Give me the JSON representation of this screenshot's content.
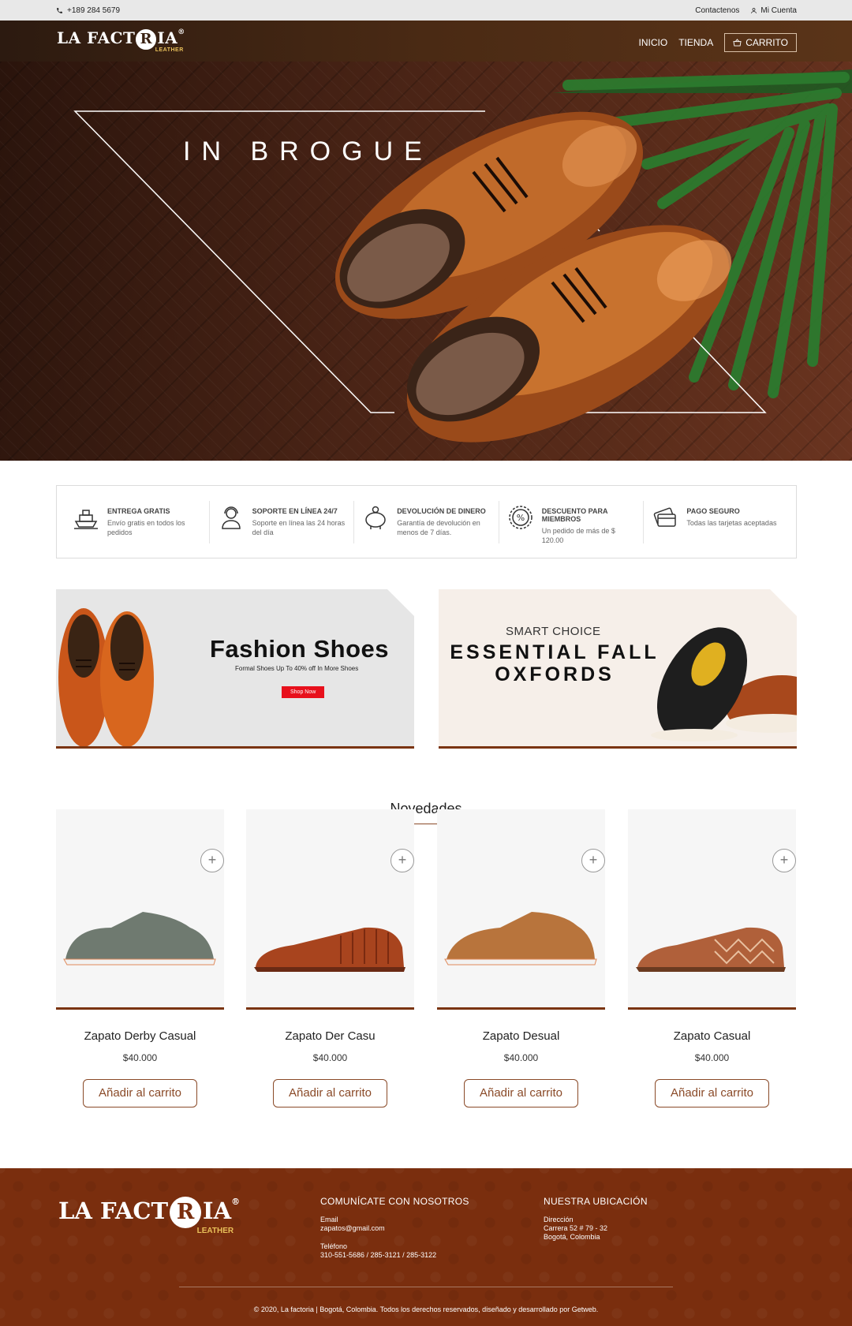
{
  "topbar": {
    "phone": "+189 284 5679",
    "contact": "Contactenos",
    "account": "Mi Cuenta"
  },
  "header": {
    "logo_text_a": "LA FACT",
    "logo_r": "R",
    "logo_text_b": "IA",
    "logo_reg": "®",
    "logo_sub": "LEATHER",
    "nav": {
      "home": "INICIO",
      "shop": "TIENDA",
      "cart": "CARRITO"
    }
  },
  "hero": {
    "title": "IN BROGUE"
  },
  "features": [
    {
      "icon": "ship-icon",
      "title": "ENTREGA GRATIS",
      "text": "Envío gratis en todos los pedidos"
    },
    {
      "icon": "support-agent-icon",
      "title": "SOPORTE EN LÍNEA 24/7",
      "text": "Soporte en línea las 24 horas del día"
    },
    {
      "icon": "piggy-bank-icon",
      "title": "DEVOLUCIÓN DE DINERO",
      "text": "Garantía de devolución en menos de 7 días."
    },
    {
      "icon": "discount-badge-icon",
      "title": "DESCUENTO PARA MIEMBROS",
      "text": "Un pedido de más de $ 120.00"
    },
    {
      "icon": "credit-card-icon",
      "title": "PAGO SEGURO",
      "text": "Todas las tarjetas aceptadas"
    }
  ],
  "banners": {
    "fashion": {
      "title": "Fashion Shoes",
      "subtitle": "Formal Shoes Up To 40% off In More Shoes",
      "button": "Shop Now"
    },
    "oxfords": {
      "kicker": "SMART CHOICE",
      "title_line1": "ESSENTIAL FALL",
      "title_line2": "OXFORDS"
    }
  },
  "novedades": {
    "title": "Novedades",
    "products": [
      {
        "name": "Zapato Derby Casual",
        "price": "$40.000",
        "button": "Añadir al carrito",
        "color": "#6f7a70"
      },
      {
        "name": "Zapato Der Casu",
        "price": "$40.000",
        "button": "Añadir al carrito",
        "color": "#a8441e"
      },
      {
        "name": "Zapato Desual",
        "price": "$40.000",
        "button": "Añadir al carrito",
        "color": "#b8743c"
      },
      {
        "name": "Zapato Casual",
        "price": "$40.000",
        "button": "Añadir al carrito",
        "color": "#b0603a"
      }
    ]
  },
  "footer": {
    "logo_text_a": "LA FACT",
    "logo_r": "R",
    "logo_text_b": "IA",
    "logo_reg": "®",
    "logo_sub": "LEATHER",
    "contact": {
      "title": "COMUNÍCATE CON NOSOTROS",
      "email_label": "Email",
      "email": "zapatos@gmail.com",
      "phone_label": "Teléfono",
      "phone": "310-551-5686 / 285-3121 / 285-3122"
    },
    "location": {
      "title": "NUESTRA UBICACIÓN",
      "label": "Dirección",
      "line1": "Carrera 52 # 79 - 32",
      "line2": "Bogotá, Colombia"
    },
    "copyright": "© 2020, La factoria | Bogotá, Colombia. Todos los derechos reservados, diseñado y desarrollado por Getweb."
  },
  "colors": {
    "brand_brown": "#7a2e0e",
    "accent_red": "#e8101c"
  }
}
